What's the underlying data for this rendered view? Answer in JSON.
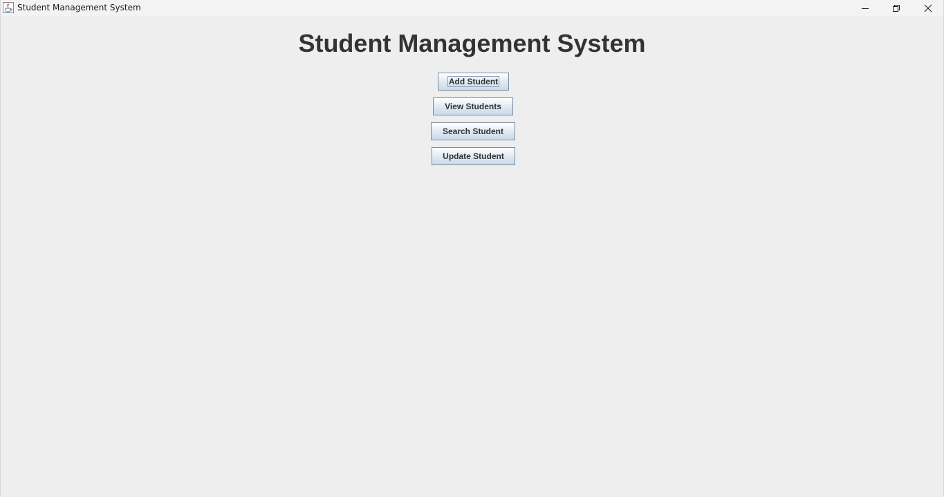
{
  "window": {
    "title": "Student Management System",
    "app_icon": "java-cup-icon",
    "controls": {
      "minimize_icon": "minimize-icon",
      "restore_icon": "restore-icon",
      "close_icon": "close-icon"
    }
  },
  "main": {
    "heading": "Student Management System",
    "buttons": [
      {
        "label": "Add Student",
        "focused": true
      },
      {
        "label": "View Students",
        "focused": false
      },
      {
        "label": "Search Student",
        "focused": false
      },
      {
        "label": "Update Student",
        "focused": false
      }
    ]
  },
  "colors": {
    "background": "#eeeeee",
    "titlebar": "#f3f3f3",
    "heading_text": "#333333",
    "button_border": "#7a8a99",
    "button_gradient_top": "#ffffff",
    "button_gradient_bottom": "#c9d9ea"
  }
}
